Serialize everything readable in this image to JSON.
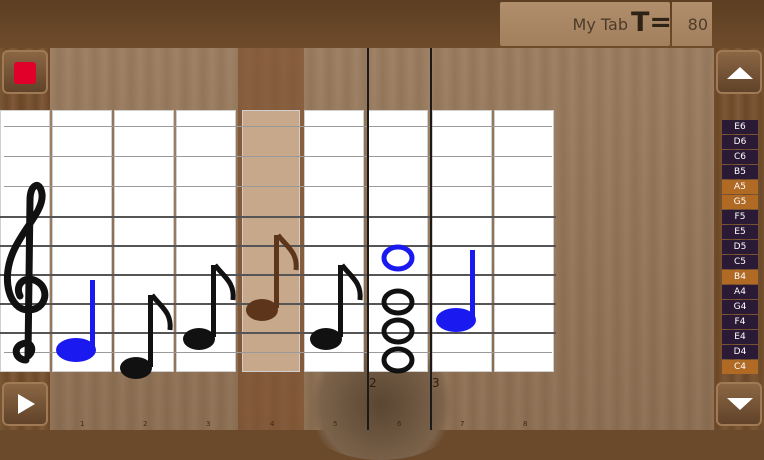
{
  "header": {
    "title": "My Tab",
    "tempo_label": "T=",
    "tempo_value": "80"
  },
  "controls": {
    "stop": "stop",
    "play": "play",
    "scroll_up": "scroll-up",
    "scroll_down": "scroll-down"
  },
  "colors": {
    "accent_blue": "#1a1af0",
    "stop_red": "#e0002a",
    "highlight_brown": "#7a4a24"
  },
  "measures": [
    "2",
    "3"
  ],
  "columns": [
    "1",
    "2",
    "3",
    "4",
    "5",
    "6",
    "7",
    "8"
  ],
  "notes": [
    "E6",
    "D6",
    "C6",
    "B5",
    "A5",
    "G5",
    "F5",
    "E5",
    "D5",
    "C5",
    "B4",
    "A4",
    "G4",
    "F4",
    "E4",
    "D4",
    "C4"
  ],
  "highlighted_notes": [
    "A5",
    "G5",
    "B4",
    "C4"
  ],
  "score": {
    "clef": "treble-clef-icon",
    "events": [
      {
        "column": "1",
        "type": "half-note",
        "color": "blue"
      },
      {
        "column": "2",
        "type": "eighth-note",
        "color": "black"
      },
      {
        "column": "3",
        "type": "eighth-note",
        "color": "black"
      },
      {
        "column": "4",
        "type": "eighth-note",
        "color": "brown",
        "selected": true
      },
      {
        "column": "5",
        "type": "eighth-note",
        "color": "black"
      },
      {
        "column": "6",
        "type": "chord",
        "color": "blue-and-black"
      },
      {
        "column": "7",
        "type": "half-note",
        "color": "blue"
      }
    ]
  }
}
